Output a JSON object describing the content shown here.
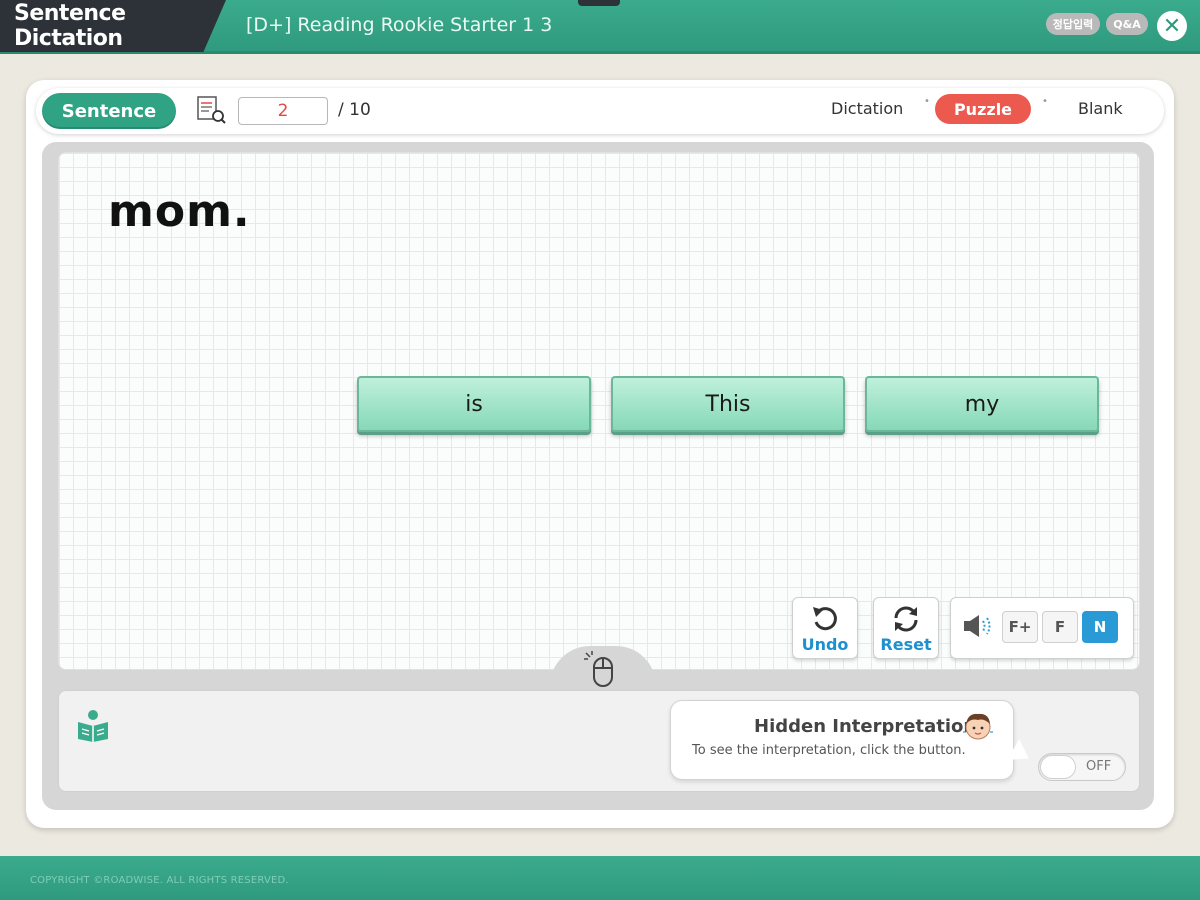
{
  "app": {
    "title": "Sentence Dictation",
    "course_title": "[D+] Reading Rookie Starter 1 3",
    "answer_button_label": "정답입력",
    "qa_button_label": "Q&A",
    "close_icon": "close-icon"
  },
  "toolbar": {
    "sentence_label": "Sentence",
    "current_page": "2",
    "total_pages": "/ 10",
    "modes": {
      "dictation": "Dictation",
      "puzzle": "Puzzle",
      "blank": "Blank"
    },
    "active_mode": "Puzzle"
  },
  "workspace": {
    "answer_text": "mom.",
    "word_blocks": [
      "is",
      "This",
      "my"
    ]
  },
  "controls": {
    "undo_label": "Undo",
    "reset_label": "Reset",
    "speeds": [
      "F+",
      "F",
      "N"
    ],
    "active_speed": "N"
  },
  "interpretation": {
    "title": "Hidden Interpretation",
    "subtitle": "To see the interpretation, click the button.",
    "toggle_label": "OFF"
  },
  "footer": {
    "copyright": "COPYRIGHT ©ROADWISE. ALL RIGHTS RESERVED."
  },
  "colors": {
    "brand_green": "#2fa383",
    "accent_red": "#ec5a4f",
    "accent_blue": "#2a9ad6",
    "word_block": "#a6e6cc"
  }
}
